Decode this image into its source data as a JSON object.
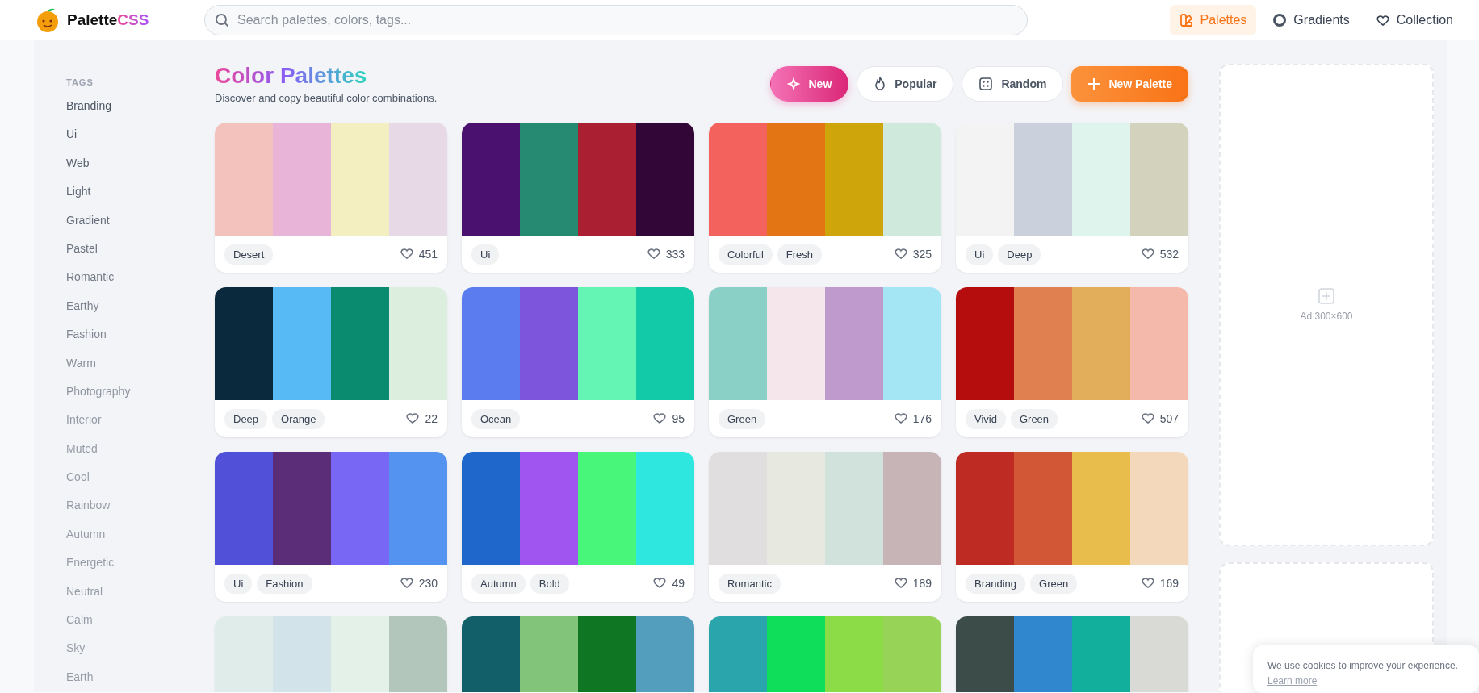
{
  "header": {
    "logo": {
      "name": "Palette",
      "accent": "CSS"
    },
    "search": {
      "placeholder": "Search palettes, colors, tags..."
    },
    "nav": [
      {
        "label": "Palettes",
        "selected": true
      },
      {
        "label": "Gradients",
        "selected": false
      },
      {
        "label": "Collection",
        "selected": false
      }
    ]
  },
  "sidebar": {
    "heading": "TAGS",
    "tags": [
      "Branding",
      "Ui",
      "Web",
      "Light",
      "Gradient",
      "Pastel",
      "Romantic",
      "Earthy",
      "Fashion",
      "Warm",
      "Photography",
      "Interior",
      "Muted",
      "Cool",
      "Rainbow",
      "Autumn",
      "Energetic",
      "Neutral",
      "Calm",
      "Sky",
      "Earth"
    ]
  },
  "main": {
    "title": "Color Palettes",
    "subtitle": "Discover and copy beautiful color combinations.",
    "sort": [
      {
        "label": "New",
        "selected": true
      },
      {
        "label": "Popular",
        "selected": false
      },
      {
        "label": "Random",
        "selected": false
      }
    ],
    "create_button": "New Palette",
    "palettes": [
      {
        "swatches": [
          {
            "color": "#f4c2bc"
          },
          {
            "color": "#e8b4d8"
          },
          {
            "color": "#f4efc0"
          },
          {
            "color": "#e8d9e6"
          }
        ],
        "tags": [
          "Desert"
        ],
        "likes": "451"
      },
      {
        "swatches": [
          {
            "color": "#4b116e"
          },
          {
            "color": "#268a72"
          },
          {
            "color": "#ab1f33"
          },
          {
            "color": "#320737"
          }
        ],
        "tags": [
          "Ui"
        ],
        "likes": "333"
      },
      {
        "swatches": [
          {
            "color": "#f4625d"
          },
          {
            "color": "#e37514"
          },
          {
            "color": "#cfa50c"
          },
          {
            "color": "#cfe9dc"
          }
        ],
        "tags": [
          "Colorful",
          "Fresh"
        ],
        "likes": "325"
      },
      {
        "swatches": [
          {
            "color": "#f3f3f3"
          },
          {
            "color": "#cbd1dc"
          },
          {
            "color": "#e0f4ee"
          },
          {
            "color": "#d3d3bd"
          }
        ],
        "tags": [
          "Ui",
          "Deep"
        ],
        "likes": "532"
      },
      {
        "swatches": [
          {
            "color": "#0b293c"
          },
          {
            "color": "#58baf4"
          },
          {
            "color": "#0a8b6f"
          },
          {
            "color": "#dcefdf"
          }
        ],
        "tags": [
          "Deep",
          "Orange"
        ],
        "likes": "22"
      },
      {
        "swatches": [
          {
            "color": "#5b7cee"
          },
          {
            "color": "#7d55dc"
          },
          {
            "color": "#64f5b4"
          },
          {
            "color": "#12c9a8"
          }
        ],
        "tags": [
          "Ocean"
        ],
        "likes": "95"
      },
      {
        "swatches": [
          {
            "color": "#8bd0c6"
          },
          {
            "color": "#f4e6ea"
          },
          {
            "color": "#bf9acd"
          },
          {
            "color": "#a4e6f4"
          }
        ],
        "tags": [
          "Green"
        ],
        "likes": "176"
      },
      {
        "swatches": [
          {
            "color": "#b50d0d"
          },
          {
            "color": "#e08050"
          },
          {
            "color": "#e3ae5c"
          },
          {
            "color": "#f4b9ab"
          }
        ],
        "tags": [
          "Vivid",
          "Green"
        ],
        "likes": "507"
      },
      {
        "swatches": [
          {
            "color": "#5150d8"
          },
          {
            "color": "#5b2c78"
          },
          {
            "color": "#7767f4"
          },
          {
            "color": "#5593f1"
          }
        ],
        "tags": [
          "Ui",
          "Fashion"
        ],
        "likes": "230"
      },
      {
        "swatches": [
          {
            "color": "#1f67cb"
          },
          {
            "color": "#a054f0"
          },
          {
            "color": "#48f77a"
          },
          {
            "color": "#2ee8e0"
          }
        ],
        "tags": [
          "Autumn",
          "Bold"
        ],
        "likes": "49"
      },
      {
        "swatches": [
          {
            "color": "#e0dedf"
          },
          {
            "color": "#e7e8e0"
          },
          {
            "color": "#d1e1dc"
          },
          {
            "color": "#c6b4b7"
          }
        ],
        "tags": [
          "Romantic"
        ],
        "likes": "189"
      },
      {
        "swatches": [
          {
            "color": "#bd2b22"
          },
          {
            "color": "#d15736"
          },
          {
            "color": "#e9bd4b"
          },
          {
            "color": "#f4d8bc"
          }
        ],
        "tags": [
          "Branding",
          "Green"
        ],
        "likes": "169"
      },
      {
        "swatches": [
          {
            "color": "#e0ecea"
          },
          {
            "color": "#d3e3ea"
          },
          {
            "color": "#e3f1e8"
          },
          {
            "color": "#b3c6bb"
          }
        ]
      },
      {
        "swatches": [
          {
            "color": "#135f69"
          },
          {
            "color": "#82c47a"
          },
          {
            "color": "#0f7624"
          },
          {
            "color": "#539ebd"
          }
        ]
      },
      {
        "swatches": [
          {
            "color": "#2aa5ac"
          },
          {
            "color": "#0fde5a"
          },
          {
            "color": "#8bdc47"
          },
          {
            "color": "#97d357"
          }
        ]
      },
      {
        "swatches": [
          {
            "color": "#3b4c49"
          },
          {
            "color": "#3087cd"
          },
          {
            "color": "#12b09c"
          },
          {
            "color": "#d9dad6"
          }
        ]
      }
    ]
  },
  "ads": [
    {
      "kind": "labeled",
      "label": "Ad 300×600"
    },
    {
      "kind": "blank"
    }
  ],
  "cookie_banner": {
    "text": "We use cookies to improve your experience.",
    "link": "Learn more"
  }
}
